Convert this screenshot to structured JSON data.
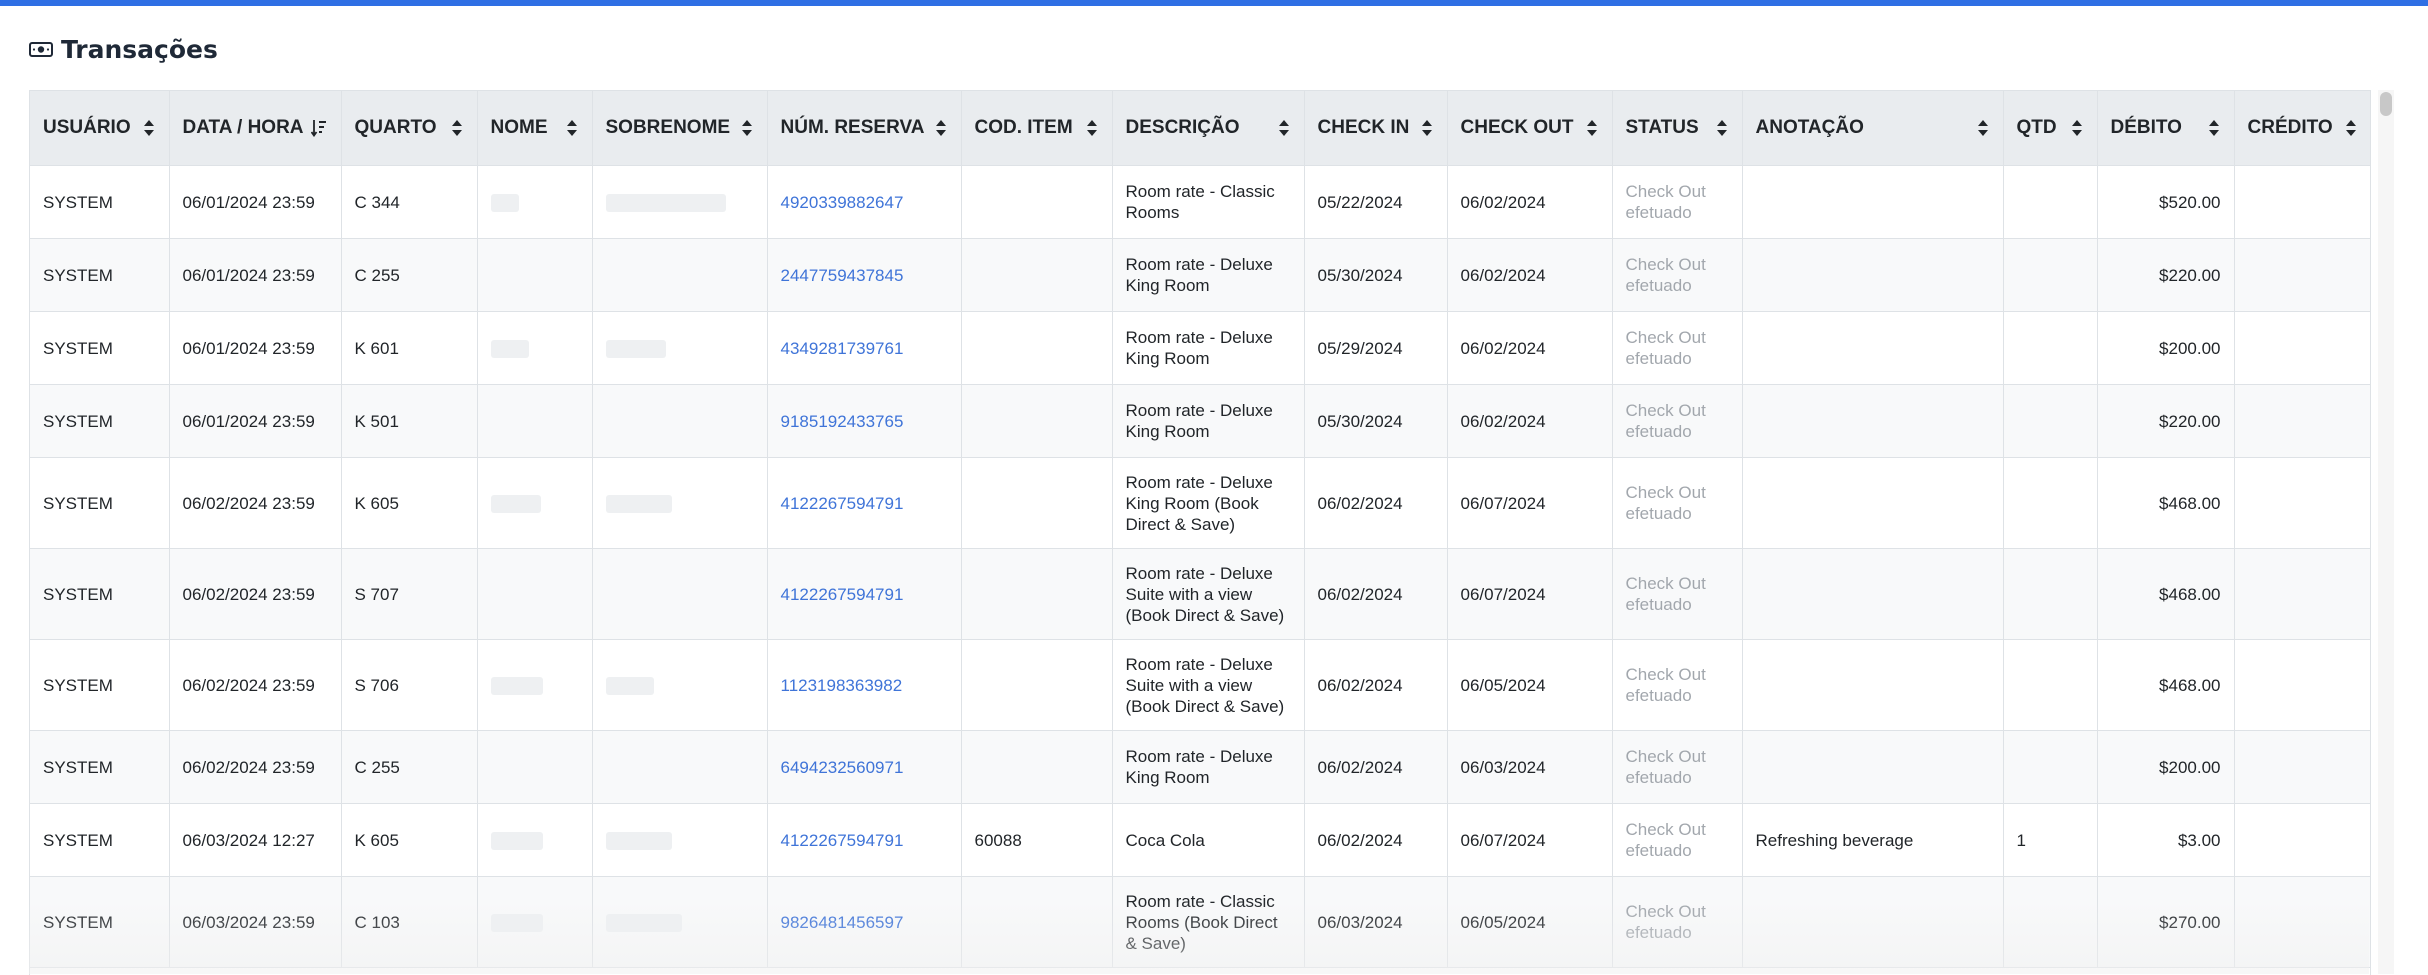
{
  "page": {
    "title": "Transações",
    "title_icon": "money-bill-icon",
    "accent_color": "#2f6fe4",
    "link_color": "#3f74d8"
  },
  "table": {
    "columns": [
      "USUÁRIO",
      "DATA / HORA",
      "QUARTO",
      "NOME",
      "SOBRENOME",
      "NÚM. RESERVA",
      "COD. ITEM",
      "DESCRIÇÃO",
      "CHECK IN",
      "CHECK OUT",
      "STATUS",
      "ANOTAÇÃO",
      "QTD",
      "DÉBITO",
      "CRÉDITO"
    ],
    "sorted_column": "DATA / HORA",
    "rows": [
      {
        "usuario": "SYSTEM",
        "data_hora": "06/01/2024 23:59",
        "quarto": "C 344",
        "reserva": "4920339882647",
        "cod_item": "",
        "descricao": "Room rate - Classic Rooms",
        "check_in": "05/22/2024",
        "check_out": "06/02/2024",
        "status": "Check Out efetuado",
        "anotacao": "",
        "qtd": "",
        "debito": "$520.00",
        "credito": ""
      },
      {
        "usuario": "SYSTEM",
        "data_hora": "06/01/2024 23:59",
        "quarto": "C 255",
        "reserva": "2447759437845",
        "cod_item": "",
        "descricao": "Room rate - Deluxe King Room",
        "check_in": "05/30/2024",
        "check_out": "06/02/2024",
        "status": "Check Out efetuado",
        "anotacao": "",
        "qtd": "",
        "debito": "$220.00",
        "credito": ""
      },
      {
        "usuario": "SYSTEM",
        "data_hora": "06/01/2024 23:59",
        "quarto": "K 601",
        "reserva": "4349281739761",
        "cod_item": "",
        "descricao": "Room rate - Deluxe King Room",
        "check_in": "05/29/2024",
        "check_out": "06/02/2024",
        "status": "Check Out efetuado",
        "anotacao": "",
        "qtd": "",
        "debito": "$200.00",
        "credito": ""
      },
      {
        "usuario": "SYSTEM",
        "data_hora": "06/01/2024 23:59",
        "quarto": "K 501",
        "reserva": "9185192433765",
        "cod_item": "",
        "descricao": "Room rate - Deluxe King Room",
        "check_in": "05/30/2024",
        "check_out": "06/02/2024",
        "status": "Check Out efetuado",
        "anotacao": "",
        "qtd": "",
        "debito": "$220.00",
        "credito": ""
      },
      {
        "usuario": "SYSTEM",
        "data_hora": "06/02/2024 23:59",
        "quarto": "K 605",
        "reserva": "4122267594791",
        "cod_item": "",
        "descricao": "Room rate - Deluxe King Room (Book Direct & Save)",
        "check_in": "06/02/2024",
        "check_out": "06/07/2024",
        "status": "Check Out efetuado",
        "anotacao": "",
        "qtd": "",
        "debito": "$468.00",
        "credito": ""
      },
      {
        "usuario": "SYSTEM",
        "data_hora": "06/02/2024 23:59",
        "quarto": "S 707",
        "reserva": "4122267594791",
        "cod_item": "",
        "descricao": "Room rate - Deluxe Suite with a view (Book Direct & Save)",
        "check_in": "06/02/2024",
        "check_out": "06/07/2024",
        "status": "Check Out efetuado",
        "anotacao": "",
        "qtd": "",
        "debito": "$468.00",
        "credito": ""
      },
      {
        "usuario": "SYSTEM",
        "data_hora": "06/02/2024 23:59",
        "quarto": "S 706",
        "reserva": "1123198363982",
        "cod_item": "",
        "descricao": "Room rate - Deluxe Suite with a view (Book Direct & Save)",
        "check_in": "06/02/2024",
        "check_out": "06/05/2024",
        "status": "Check Out efetuado",
        "anotacao": "",
        "qtd": "",
        "debito": "$468.00",
        "credito": ""
      },
      {
        "usuario": "SYSTEM",
        "data_hora": "06/02/2024 23:59",
        "quarto": "C 255",
        "reserva": "6494232560971",
        "cod_item": "",
        "descricao": "Room rate - Deluxe King Room",
        "check_in": "06/02/2024",
        "check_out": "06/03/2024",
        "status": "Check Out efetuado",
        "anotacao": "",
        "qtd": "",
        "debito": "$200.00",
        "credito": ""
      },
      {
        "usuario": "SYSTEM",
        "data_hora": "06/03/2024 12:27",
        "quarto": "K 605",
        "reserva": "4122267594791",
        "cod_item": "60088",
        "descricao": "Coca Cola",
        "check_in": "06/02/2024",
        "check_out": "06/07/2024",
        "status": "Check Out efetuado",
        "anotacao": "Refreshing beverage",
        "qtd": "1",
        "debito": "$3.00",
        "credito": ""
      },
      {
        "usuario": "SYSTEM",
        "data_hora": "06/03/2024 23:59",
        "quarto": "C 103",
        "reserva": "9826481456597",
        "cod_item": "",
        "descricao": "Room rate - Classic Rooms (Book Direct & Save)",
        "check_in": "06/03/2024",
        "check_out": "06/05/2024",
        "status": "Check Out efetuado",
        "anotacao": "",
        "qtd": "",
        "debito": "$270.00",
        "credito": ""
      }
    ]
  }
}
